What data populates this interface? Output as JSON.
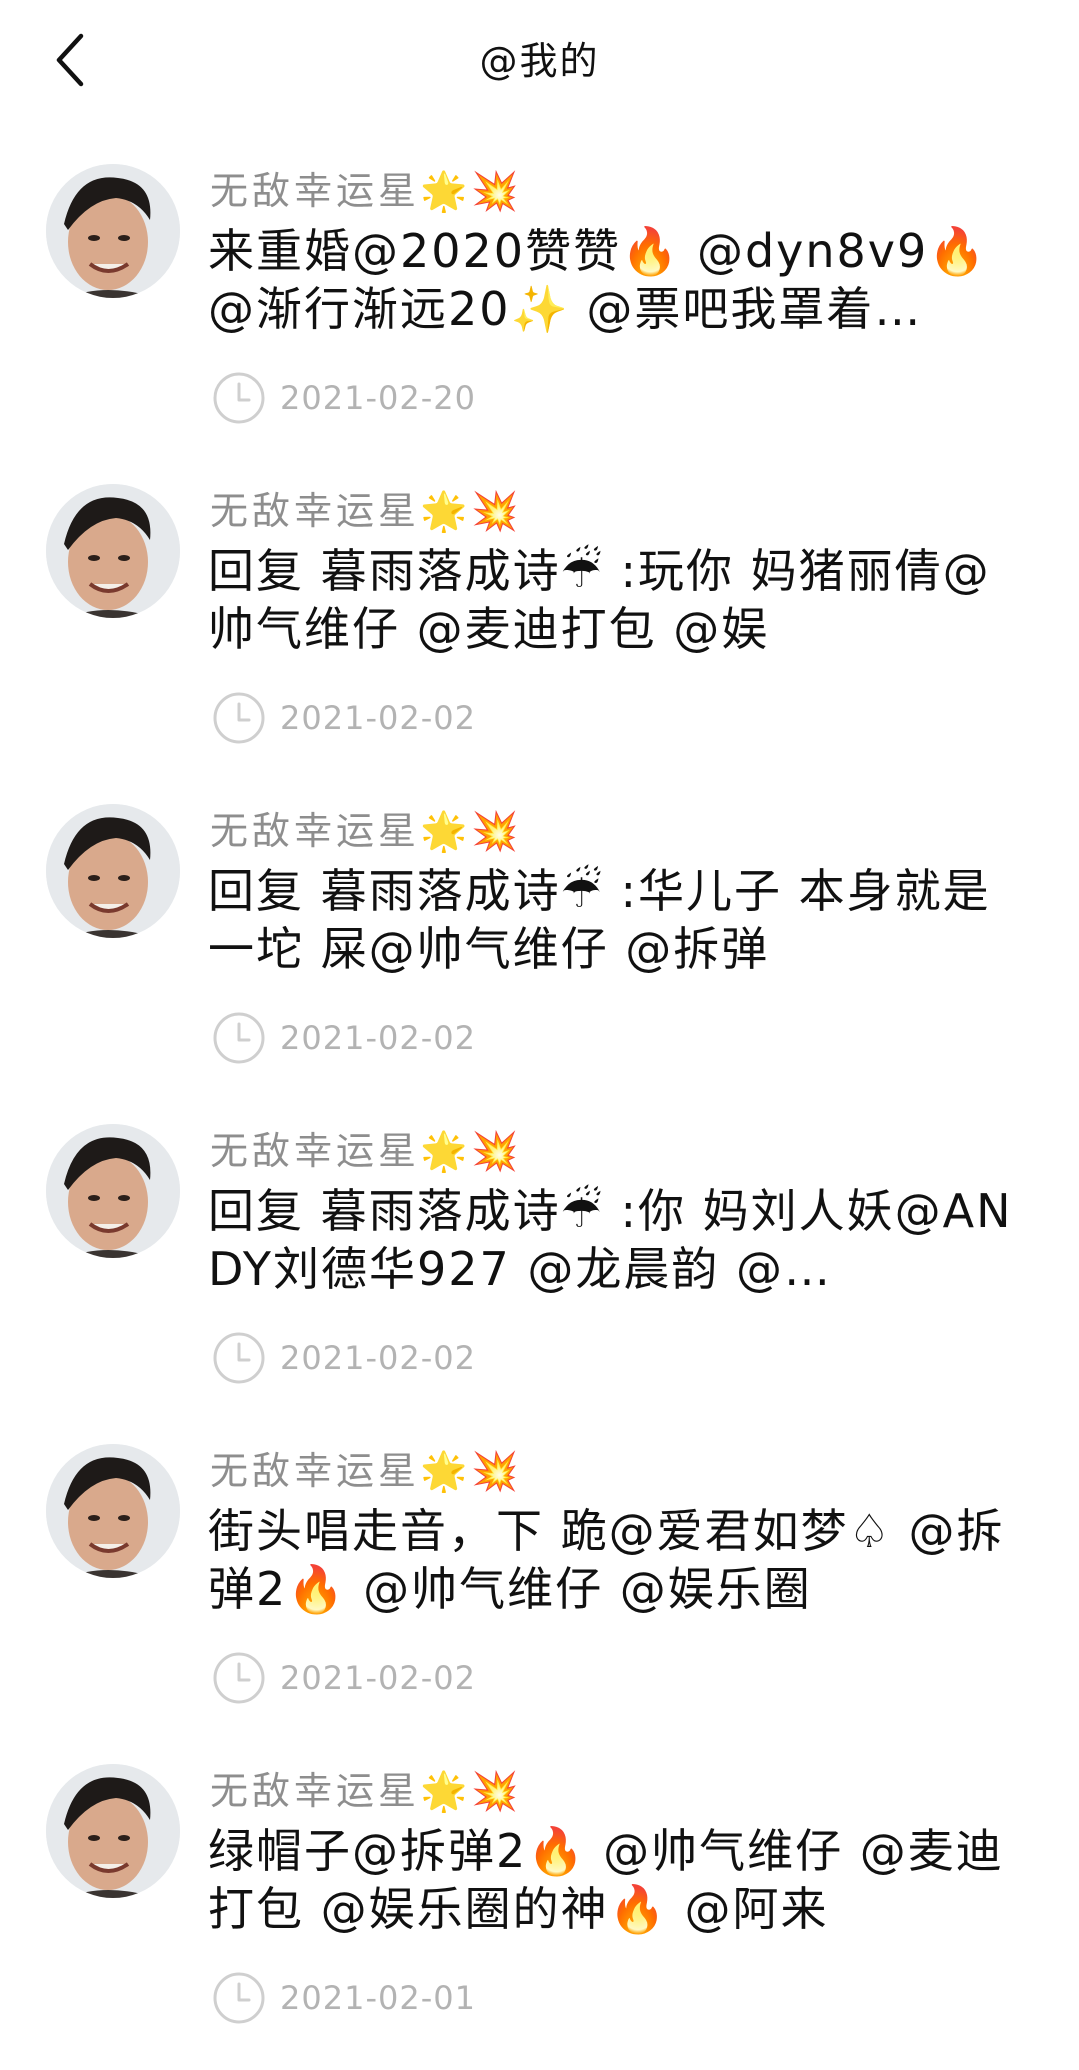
{
  "header": {
    "title": "@我的"
  },
  "items": [
    {
      "name": "无敌幸运星🌟💥",
      "content": "来重婚@2020赞赞🔥 @dyn8v9🔥 @渐行渐远20✨ @票吧我罩着…",
      "time": "2021-02-20"
    },
    {
      "name": "无敌幸运星🌟💥",
      "content": "回复 暮雨落成诗☔ :玩你 妈猪丽倩@帅气维仔 @麦迪打包 @娱",
      "time": "2021-02-02"
    },
    {
      "name": "无敌幸运星🌟💥",
      "content": "回复 暮雨落成诗☔ :华儿子 本身就是一坨 屎@帅气维仔 @拆弹",
      "time": "2021-02-02"
    },
    {
      "name": "无敌幸运星🌟💥",
      "content": "回复 暮雨落成诗☔ :你 妈刘人妖@ANDY刘德华927 @龙晨韵 @…",
      "time": "2021-02-02"
    },
    {
      "name": "无敌幸运星🌟💥",
      "content": "街头唱走音，下 跪@爱君如梦♤ @拆弹2🔥 @帅气维仔 @娱乐圈",
      "time": "2021-02-02"
    },
    {
      "name": "无敌幸运星🌟💥",
      "content": "绿帽子@拆弹2🔥 @帅气维仔 @麦迪打包 @娱乐圈的神🔥 @阿来",
      "time": "2021-02-01"
    }
  ]
}
